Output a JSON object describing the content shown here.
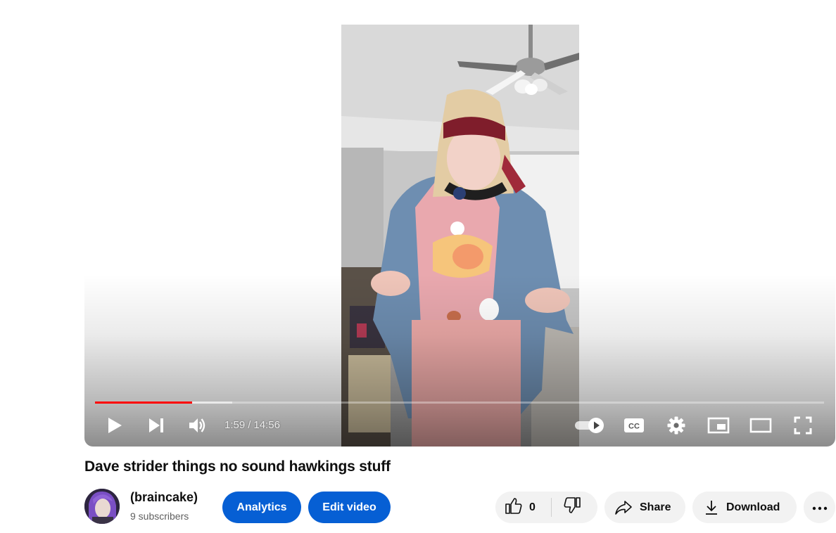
{
  "player": {
    "current_time": "1:59",
    "time_separator": "/",
    "duration": "14:56",
    "progress_played_fraction": 0.133,
    "progress_buffered_fraction": 0.188,
    "autoplay_on": true,
    "controls": {
      "play": "play-icon",
      "next": "next-icon",
      "volume": "volume-icon",
      "autoplay": "autoplay-toggle-icon",
      "captions": "cc-icon",
      "settings": "gear-icon",
      "miniplayer": "miniplayer-icon",
      "theater": "theater-mode-icon",
      "fullscreen": "fullscreen-icon"
    },
    "accent_color": "#ff0000"
  },
  "video": {
    "title": "Dave strider things no sound hawkings stuff"
  },
  "channel": {
    "name": "(braincake)",
    "subscribers": "9 subscribers"
  },
  "actions": {
    "analytics_label": "Analytics",
    "edit_label": "Edit video",
    "like_count": "0",
    "share_label": "Share",
    "download_label": "Download",
    "primary_color": "#065fd4",
    "chip_color": "#f2f2f2"
  }
}
